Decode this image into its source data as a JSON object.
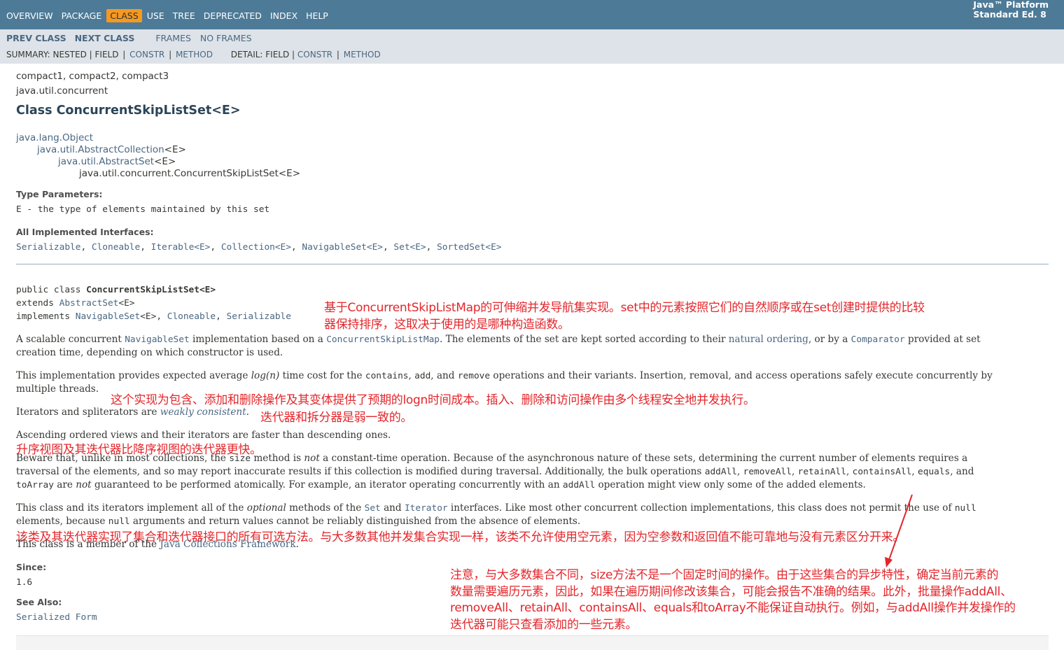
{
  "topnav": {
    "items": [
      "OVERVIEW",
      "PACKAGE",
      "CLASS",
      "USE",
      "TREE",
      "DEPRECATED",
      "INDEX",
      "HELP"
    ],
    "active": "CLASS",
    "platform_line1": "Java™ Platform",
    "platform_line2": "Standard Ed. 8"
  },
  "subnav": {
    "prev_class": "PREV CLASS",
    "next_class": "NEXT CLASS",
    "frames": "FRAMES",
    "no_frames": "NO FRAMES",
    "summary_label": "SUMMARY: NESTED |",
    "summary_field": "FIELD",
    "summary_constr": "CONSTR",
    "summary_method": "METHOD",
    "detail_label": "DETAIL: FIELD |",
    "detail_constr": "CONSTR",
    "detail_method": "METHOD",
    "pipe": "|"
  },
  "header": {
    "profiles": "compact1, compact2, compact3",
    "package": "java.util.concurrent",
    "title": "Class ConcurrentSkipListSet<E>"
  },
  "hierarchy": [
    {
      "text": "java.lang.Object",
      "link": true
    },
    {
      "text": "java.util.AbstractCollection",
      "suffix": "<E>",
      "link": true
    },
    {
      "text": "java.util.AbstractSet",
      "suffix": "<E>",
      "link": true
    },
    {
      "text": "java.util.concurrent.ConcurrentSkipListSet<E>",
      "link": false
    }
  ],
  "type_params": {
    "label": "Type Parameters:",
    "value": "E - the type of elements maintained by this set"
  },
  "interfaces": {
    "label": "All Implemented Interfaces:",
    "items": [
      "Serializable",
      "Cloneable",
      "Iterable<E>",
      "Collection<E>",
      "NavigableSet<E>",
      "Set<E>",
      "SortedSet<E>"
    ]
  },
  "signature": {
    "line1_a": "public class ",
    "line1_b": "ConcurrentSkipListSet<E>",
    "line2_a": "extends ",
    "line2_b": "AbstractSet",
    "line2_c": "<E>",
    "line3_a": "implements ",
    "line3_b": "NavigableSet",
    "line3_c": "<E>, ",
    "line3_d": "Cloneable",
    "line3_e": ", ",
    "line3_f": "Serializable"
  },
  "description": {
    "p1_a": "A scalable concurrent ",
    "p1_b": "NavigableSet",
    "p1_c": " implementation based on a ",
    "p1_d": "ConcurrentSkipListMap",
    "p1_e": ". The elements of the set are kept sorted according to their ",
    "p1_f": "natural ordering",
    "p1_g": ", or by a ",
    "p1_h": "Comparator",
    "p1_i": " provided at set",
    "p1_line2": "creation time, depending on which constructor is used.",
    "p2_a": "This implementation provides expected average ",
    "p2_b": "log(n)",
    "p2_c": " time cost for the ",
    "p2_d": "contains",
    "p2_e": ", ",
    "p2_f": "add",
    "p2_g": ", and ",
    "p2_h": "remove",
    "p2_i": " operations and their variants. Insertion, removal, and access operations safely execute concurrently by",
    "p2_line2": "multiple threads.",
    "p3_a": "Iterators and spliterators are ",
    "p3_b": "weakly consistent",
    "p3_c": ".",
    "p4": "Ascending ordered views and their iterators are faster than descending ones.",
    "p5_a": "Beware that, unlike in most collections, the ",
    "p5_b": "size",
    "p5_c": " method is ",
    "p5_d": "not",
    "p5_e": " a constant-time operation. Because of the asynchronous nature of these sets, determining the current number of elements requires a",
    "p5_line2_a": "traversal of the elements, and so may report inaccurate results if this collection is modified during traversal. Additionally, the bulk operations ",
    "p5_line2_b": "addAll",
    "p5_line2_c": ", ",
    "p5_line2_d": "removeAll",
    "p5_line2_e": ", ",
    "p5_line2_f": "retainAll",
    "p5_line2_g": ", ",
    "p5_line2_h": "containsAll",
    "p5_line2_i": ", ",
    "p5_line2_j": "equals",
    "p5_line2_k": ", and",
    "p5_line3_a": "toArray",
    "p5_line3_b": " are ",
    "p5_line3_c": "not",
    "p5_line3_d": " guaranteed to be performed atomically. For example, an iterator operating concurrently with an ",
    "p5_line3_e": "addAll",
    "p5_line3_f": " operation might view only some of the added elements.",
    "p6_a": "This class and its iterators implement all of the ",
    "p6_b": "optional",
    "p6_c": " methods of the ",
    "p6_d": "Set",
    "p6_e": " and ",
    "p6_f": "Iterator",
    "p6_g": " interfaces. Like most other concurrent collection implementations, this class does not permit the use of ",
    "p6_h": "null",
    "p6_line2_a": "elements, because ",
    "p6_line2_b": "null",
    "p6_line2_c": " arguments and return values cannot be reliably distinguished from the absence of elements.",
    "p7_a": "This class is a member of the ",
    "p7_b": "Java Collections Framework",
    "p7_c": "."
  },
  "since": {
    "label": "Since:",
    "value": "1.6"
  },
  "see_also": {
    "label": "See Also:",
    "value": "Serialized Form"
  },
  "annotations": {
    "a1_line1": "基于ConcurrentSkipListMap的可伸缩并发导航集实现。set中的元素按照它们的自然顺序或在set创建时提供的比较",
    "a1_line2": "器保持排序，这取决于使用的是哪种构造函数。",
    "a2": "这个实现为包含、添加和删除操作及其变体提供了预期的logn时间成本。插入、删除和访问操作由多个线程安全地并发执行。",
    "a3": "迭代器和拆分器是弱一致的。",
    "a4": "升序视图及其迭代器比降序视图的迭代器更快。",
    "a5": "该类及其迭代器实现了集合和迭代器接口的所有可选方法。与大多数其他并发集合实现一样，该类不允许使用空元素，因为空参数和返回值不能可靠地与没有元素区分开来。",
    "a6_line1": "注意，与大多数集合不同，size方法不是一个固定时间的操作。由于这些集合的异步特性，确定当前元素的",
    "a6_line2": "数量需要遍历元素，因此，如果在遍历期间修改该集合，可能会报告不准确的结果。此外，批量操作addAll、",
    "a6_line3": "removeAll、retainAll、containsAll、equals和toArray不能保证自动执行。例如，与addAll操作并发操作的",
    "a6_line4": "迭代器可能只查看添加的一些元素。"
  },
  "colors": {
    "topnav_bg": "#4d7a97",
    "active_tab": "#f8981d",
    "subnav_bg": "#dee3e9",
    "link": "#4a6782",
    "annotation": "#e3262b"
  }
}
